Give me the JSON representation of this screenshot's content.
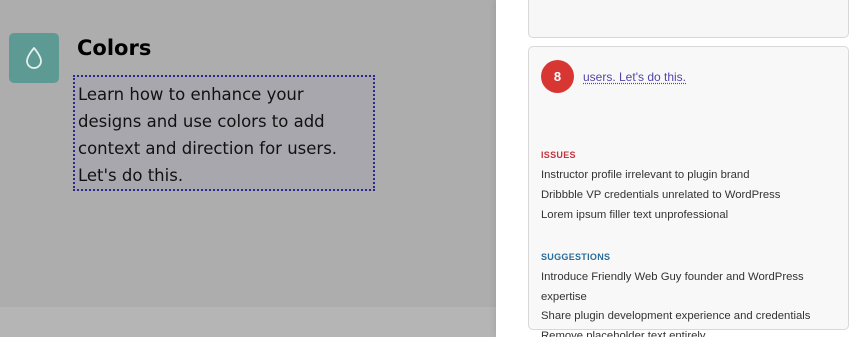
{
  "card": {
    "icon": "droplet-icon",
    "title": "Colors",
    "description": "Learn how to enhance your designs and use colors to add context and direction for users. Let's do this."
  },
  "feedback": {
    "score": "8",
    "link_text": "users. Let's do this.",
    "issues_label": "ISSUES",
    "issues": [
      "Instructor profile irrelevant to plugin brand",
      "Dribbble VP credentials unrelated to WordPress",
      "Lorem ipsum filler text unprofessional"
    ],
    "suggestions_label": "SUGGESTIONS",
    "suggestions": [
      "Introduce Friendly Web Guy founder and WordPress expertise",
      "Share plugin development experience and credentials",
      "Remove placeholder text entirely"
    ]
  },
  "colors": {
    "icon_bg": "#5d9a93",
    "score_badge": "#d83632",
    "issues": "#c8323a",
    "suggestions": "#2a6b9a",
    "link": "#5046a8"
  }
}
